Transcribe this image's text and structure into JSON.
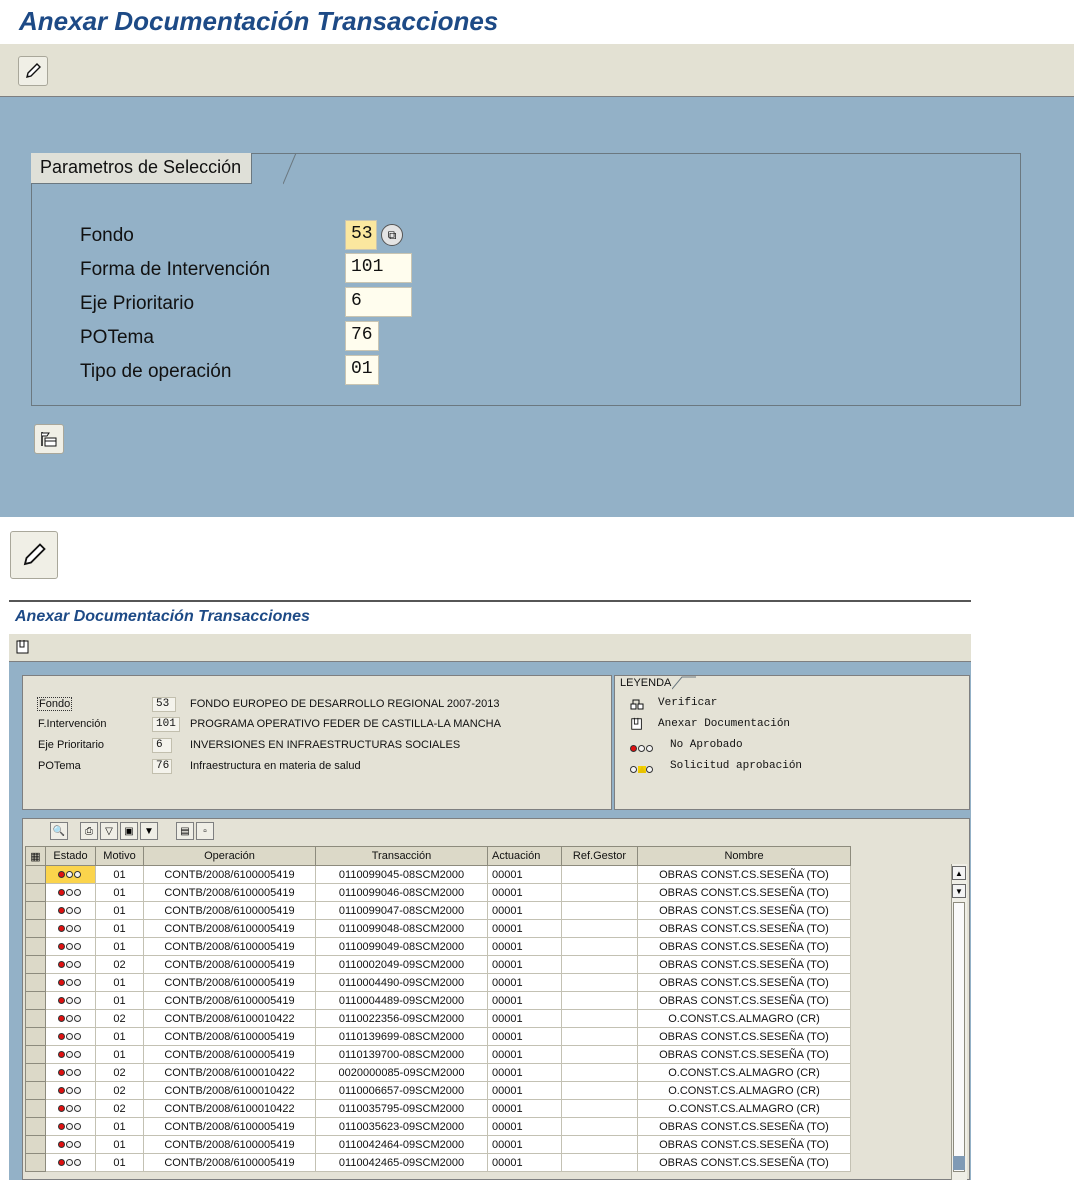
{
  "screen1": {
    "title": "Anexar Documentación Transacciones",
    "frame_title": "Parametros de Selección",
    "fields": [
      {
        "label": "Fondo",
        "value": "53"
      },
      {
        "label": "Forma de Intervención",
        "value": "101"
      },
      {
        "label": "Eje Prioritario",
        "value": "6"
      },
      {
        "label": "POTema",
        "value": "76"
      },
      {
        "label": "Tipo de operación",
        "value": "01"
      }
    ]
  },
  "screen2": {
    "title": "Anexar Documentación Transacciones",
    "header": {
      "rows": [
        {
          "label": "Fondo",
          "code": "53",
          "text": "FONDO EUROPEO DE DESARROLLO REGIONAL  2007-2013"
        },
        {
          "label": "F.Intervención",
          "code": "101",
          "text": "PROGRAMA OPERATIVO FEDER DE CASTILLA-LA MANCHA"
        },
        {
          "label": "Eje Prioritario",
          "code": "6",
          "text": "INVERSIONES EN INFRAESTRUCTURAS SOCIALES"
        },
        {
          "label": "POTema",
          "code": "76",
          "text": "Infraestructura en materia de salud"
        }
      ]
    },
    "legend": {
      "title": "LEYENDA",
      "items": [
        {
          "icon": "verify-icon",
          "text": "Verificar"
        },
        {
          "icon": "attach-doc-icon",
          "text": "Anexar Documentación"
        },
        {
          "icon": "red-light-icon",
          "text": "No Aprobado"
        },
        {
          "icon": "yellow-light-icon",
          "text": "Solicitud aprobación"
        }
      ]
    },
    "grid": {
      "columns": [
        "Estado",
        "Motivo",
        "Operación",
        "Transacción",
        "Actuación",
        "Ref.Gestor",
        "Nombre"
      ],
      "rows": [
        {
          "motivo": "01",
          "operacion": "CONTB/2008/6100005419",
          "transaccion": "0110099045-08SCM2000",
          "actuacion": "00001",
          "ref": "",
          "nombre": "OBRAS CONST.CS.SESEÑA (TO)"
        },
        {
          "motivo": "01",
          "operacion": "CONTB/2008/6100005419",
          "transaccion": "0110099046-08SCM2000",
          "actuacion": "00001",
          "ref": "",
          "nombre": "OBRAS CONST.CS.SESEÑA (TO)"
        },
        {
          "motivo": "01",
          "operacion": "CONTB/2008/6100005419",
          "transaccion": "0110099047-08SCM2000",
          "actuacion": "00001",
          "ref": "",
          "nombre": "OBRAS CONST.CS.SESEÑA (TO)"
        },
        {
          "motivo": "01",
          "operacion": "CONTB/2008/6100005419",
          "transaccion": "0110099048-08SCM2000",
          "actuacion": "00001",
          "ref": "",
          "nombre": "OBRAS CONST.CS.SESEÑA (TO)"
        },
        {
          "motivo": "01",
          "operacion": "CONTB/2008/6100005419",
          "transaccion": "0110099049-08SCM2000",
          "actuacion": "00001",
          "ref": "",
          "nombre": "OBRAS CONST.CS.SESEÑA (TO)"
        },
        {
          "motivo": "02",
          "operacion": "CONTB/2008/6100005419",
          "transaccion": "0110002049-09SCM2000",
          "actuacion": "00001",
          "ref": "",
          "nombre": "OBRAS CONST.CS.SESEÑA (TO)"
        },
        {
          "motivo": "01",
          "operacion": "CONTB/2008/6100005419",
          "transaccion": "0110004490-09SCM2000",
          "actuacion": "00001",
          "ref": "",
          "nombre": "OBRAS CONST.CS.SESEÑA (TO)"
        },
        {
          "motivo": "01",
          "operacion": "CONTB/2008/6100005419",
          "transaccion": "0110004489-09SCM2000",
          "actuacion": "00001",
          "ref": "",
          "nombre": "OBRAS CONST.CS.SESEÑA (TO)"
        },
        {
          "motivo": "02",
          "operacion": "CONTB/2008/6100010422",
          "transaccion": "0110022356-09SCM2000",
          "actuacion": "00001",
          "ref": "",
          "nombre": "O.CONST.CS.ALMAGRO (CR)"
        },
        {
          "motivo": "01",
          "operacion": "CONTB/2008/6100005419",
          "transaccion": "0110139699-08SCM2000",
          "actuacion": "00001",
          "ref": "",
          "nombre": "OBRAS CONST.CS.SESEÑA (TO)"
        },
        {
          "motivo": "01",
          "operacion": "CONTB/2008/6100005419",
          "transaccion": "0110139700-08SCM2000",
          "actuacion": "00001",
          "ref": "",
          "nombre": "OBRAS CONST.CS.SESEÑA (TO)"
        },
        {
          "motivo": "02",
          "operacion": "CONTB/2008/6100010422",
          "transaccion": "0020000085-09SCM2000",
          "actuacion": "00001",
          "ref": "",
          "nombre": "O.CONST.CS.ALMAGRO (CR)"
        },
        {
          "motivo": "02",
          "operacion": "CONTB/2008/6100010422",
          "transaccion": "0110006657-09SCM2000",
          "actuacion": "00001",
          "ref": "",
          "nombre": "O.CONST.CS.ALMAGRO (CR)"
        },
        {
          "motivo": "02",
          "operacion": "CONTB/2008/6100010422",
          "transaccion": "0110035795-09SCM2000",
          "actuacion": "00001",
          "ref": "",
          "nombre": "O.CONST.CS.ALMAGRO (CR)"
        },
        {
          "motivo": "01",
          "operacion": "CONTB/2008/6100005419",
          "transaccion": "0110035623-09SCM2000",
          "actuacion": "00001",
          "ref": "",
          "nombre": "OBRAS CONST.CS.SESEÑA (TO)"
        },
        {
          "motivo": "01",
          "operacion": "CONTB/2008/6100005419",
          "transaccion": "0110042464-09SCM2000",
          "actuacion": "00001",
          "ref": "",
          "nombre": "OBRAS CONST.CS.SESEÑA (TO)"
        },
        {
          "motivo": "01",
          "operacion": "CONTB/2008/6100005419",
          "transaccion": "0110042465-09SCM2000",
          "actuacion": "00001",
          "ref": "",
          "nombre": "OBRAS CONST.CS.SESEÑA (TO)"
        }
      ]
    }
  }
}
